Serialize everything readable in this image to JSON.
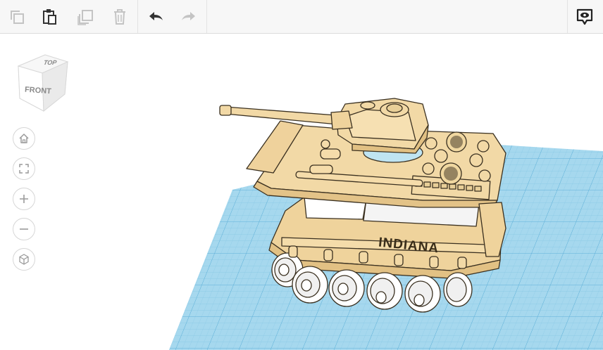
{
  "toolbar": {
    "buttons": [
      {
        "name": "copy",
        "icon": "copy-icon",
        "enabled": false
      },
      {
        "name": "paste",
        "icon": "paste-icon",
        "enabled": true
      },
      {
        "name": "duplicate",
        "icon": "duplicate-icon",
        "enabled": false
      },
      {
        "name": "delete",
        "icon": "trash-icon",
        "enabled": false
      },
      {
        "name": "undo",
        "icon": "undo-arrow-icon",
        "enabled": true
      },
      {
        "name": "redo",
        "icon": "redo-arrow-icon",
        "enabled": false
      },
      {
        "name": "notes",
        "icon": "speech-eye-icon",
        "enabled": true
      }
    ]
  },
  "viewcube": {
    "top_label": "TOP",
    "front_label": "FRONT"
  },
  "nav": [
    {
      "name": "home-view",
      "icon": "home-icon"
    },
    {
      "name": "fit-view",
      "icon": "fit-frame-icon"
    },
    {
      "name": "zoom-in",
      "icon": "plus-icon"
    },
    {
      "name": "zoom-out",
      "icon": "minus-icon"
    },
    {
      "name": "perspective",
      "icon": "cube-icon"
    }
  ],
  "model": {
    "label_text": "INDIANA"
  },
  "colors": {
    "grid": "#9fd3ec",
    "grid_line": "#7cc0e0",
    "model": "#f2d9a6",
    "model_outline": "#3a3020",
    "disabled_icon": "#c4c4c4",
    "enabled_icon": "#333333"
  }
}
